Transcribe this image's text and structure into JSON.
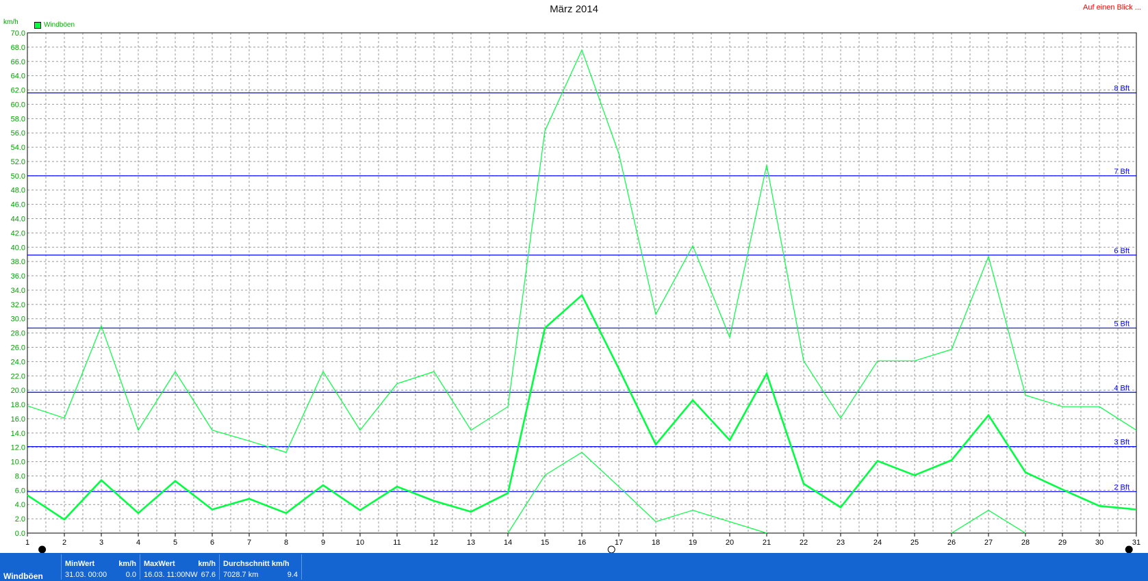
{
  "title": "März 2014",
  "top_link": "Auf einen Blick ...",
  "unit": "km/h",
  "legend": "Windböen",
  "colors": {
    "series": "#00ff40",
    "beaufort": "#0000ff",
    "grid": "#999999",
    "footer": "#1464d2",
    "link": "#ff0000"
  },
  "footer": {
    "series_name": "Windböen",
    "min": {
      "label": "MinWert",
      "unit": "km/h",
      "date": "31.03.  00:00",
      "value": "0.0"
    },
    "max": {
      "label": "MaxWert",
      "unit": "km/h",
      "date": "16.03.  11:00NW",
      "value": "67.6"
    },
    "avg": {
      "label": "Durchschnitt km/h",
      "distance": "7028.7 km",
      "value": "9.4"
    }
  },
  "chart_data": {
    "type": "line",
    "xlim": [
      1,
      31
    ],
    "ylim": [
      0,
      70
    ],
    "ytick_step": 2,
    "x_ticks": [
      1,
      2,
      3,
      4,
      5,
      6,
      7,
      8,
      9,
      10,
      11,
      12,
      13,
      14,
      15,
      16,
      17,
      18,
      19,
      20,
      21,
      22,
      23,
      24,
      25,
      26,
      27,
      28,
      29,
      30,
      31
    ],
    "beaufort_lines": [
      {
        "label": "2 Bft",
        "value": 5.8
      },
      {
        "label": "3 Bft",
        "value": 12.1
      },
      {
        "label": "4 Bft",
        "value": 19.7
      },
      {
        "label": "5 Bft",
        "value": 28.7
      },
      {
        "label": "6 Bft",
        "value": 38.9
      },
      {
        "label": "7 Bft",
        "value": 50.0
      },
      {
        "label": "8 Bft",
        "value": 61.6
      }
    ],
    "series": [
      {
        "role": "max",
        "x": [
          1,
          2,
          3,
          4,
          5,
          6,
          7,
          8,
          9,
          10,
          11,
          12,
          13,
          14,
          15,
          16,
          17,
          18,
          19,
          20,
          21,
          22,
          23,
          24,
          25,
          26,
          27,
          28,
          29,
          30,
          31
        ],
        "y": [
          17.8,
          16.1,
          29.0,
          14.4,
          22.6,
          14.4,
          12.9,
          11.3,
          22.6,
          14.4,
          20.9,
          22.6,
          14.4,
          17.7,
          56.3,
          67.6,
          53.1,
          30.6,
          40.2,
          27.4,
          51.5,
          24.1,
          16.1,
          24.1,
          24.1,
          25.7,
          38.7,
          19.3,
          17.7,
          17.7,
          14.4
        ]
      },
      {
        "role": "avg",
        "x": [
          1,
          2,
          3,
          4,
          5,
          6,
          7,
          8,
          9,
          10,
          11,
          12,
          13,
          14,
          15,
          16,
          17,
          18,
          19,
          20,
          21,
          22,
          23,
          24,
          25,
          26,
          27,
          28,
          29,
          30,
          31
        ],
        "y": [
          5.3,
          1.9,
          7.4,
          2.8,
          7.3,
          3.3,
          4.8,
          2.8,
          6.7,
          3.2,
          6.5,
          4.5,
          3.0,
          5.6,
          28.7,
          33.3,
          23.0,
          12.4,
          18.6,
          13.0,
          22.3,
          6.9,
          3.6,
          10.1,
          8.1,
          10.2,
          16.5,
          8.5,
          6.1,
          3.8,
          3.3
        ]
      },
      {
        "role": "min",
        "x": [
          14,
          15,
          16,
          17,
          18,
          19,
          20,
          21
        ],
        "y": [
          0.0,
          8.1,
          11.3,
          6.5,
          1.6,
          3.2,
          1.6,
          0.0
        ]
      },
      {
        "role": "min",
        "x": [
          26,
          27,
          28
        ],
        "y": [
          0.0,
          3.2,
          0.0
        ]
      }
    ]
  }
}
